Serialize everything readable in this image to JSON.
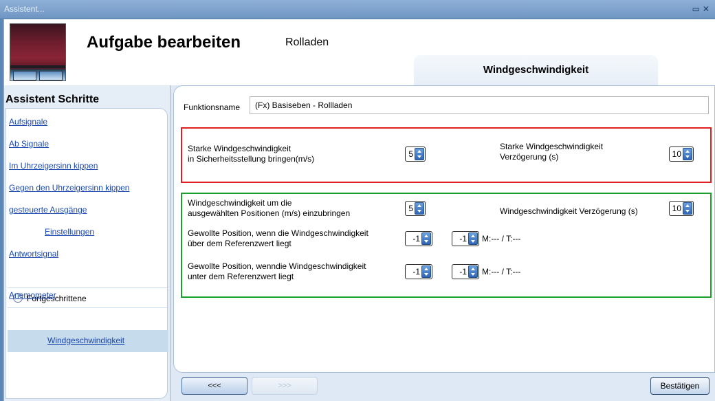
{
  "window": {
    "title": "Assistent..."
  },
  "header": {
    "title": "Aufgabe bearbeiten",
    "subtitle": "Rolladen",
    "tab": "Windgeschwindigkeit"
  },
  "sidebar": {
    "heading": "Assistent Schritte",
    "steps": [
      "Aufsignale",
      "Ab Signale",
      "Im Uhrzeigersinn kippen",
      "Gegen den Uhrzeigersinn kippen",
      "gesteuerte Ausgänge",
      "Einstellungen",
      "Antwortsignal"
    ],
    "advanced": "Fortgeschrittene",
    "anemometer": "Anemometer",
    "selected": "Windgeschwindigkeit"
  },
  "form": {
    "function_label": "Funktionsname",
    "function_value": "(Fx) Basiseben - Rollladen",
    "strong": {
      "label_line1": "Starke Windgeschwindigkeit",
      "label_line2": " in Sicherheitsstellung bringen(m/s)",
      "value": "5",
      "delay_line1": "Starke Windgeschwindigkeit",
      "delay_line2": "Verzögerung (s)",
      "delay_value": "10"
    },
    "positions": {
      "label_line1": "Windgeschwindigkeit um die",
      "label_line2": " ausgewählten Positionen (m/s) einzubringen",
      "value": "5",
      "delay_label": "Windgeschwindigkeit Verzögerung (s)",
      "delay_value": "10",
      "above_line1": "Gewollte Position, wenn die Windgeschwindigkeit",
      "above_line2": "über dem Referenzwert liegt",
      "above_v1": "-1",
      "above_v2": "-1",
      "above_mt": "M:--- / T:---",
      "below_line1": "Gewollte Position, wenndie Windgeschwindigkeit",
      "below_line2": "unter dem Referenzwert liegt",
      "below_v1": "-1",
      "below_v2": "-1",
      "below_mt": "M:--- / T:---"
    }
  },
  "footer": {
    "prev": "<<<",
    "next": ">>>",
    "confirm": "Bestätigen"
  },
  "colors": {
    "red_box": "#e02020",
    "green_box": "#1aa12c",
    "link": "#1a47b0"
  }
}
